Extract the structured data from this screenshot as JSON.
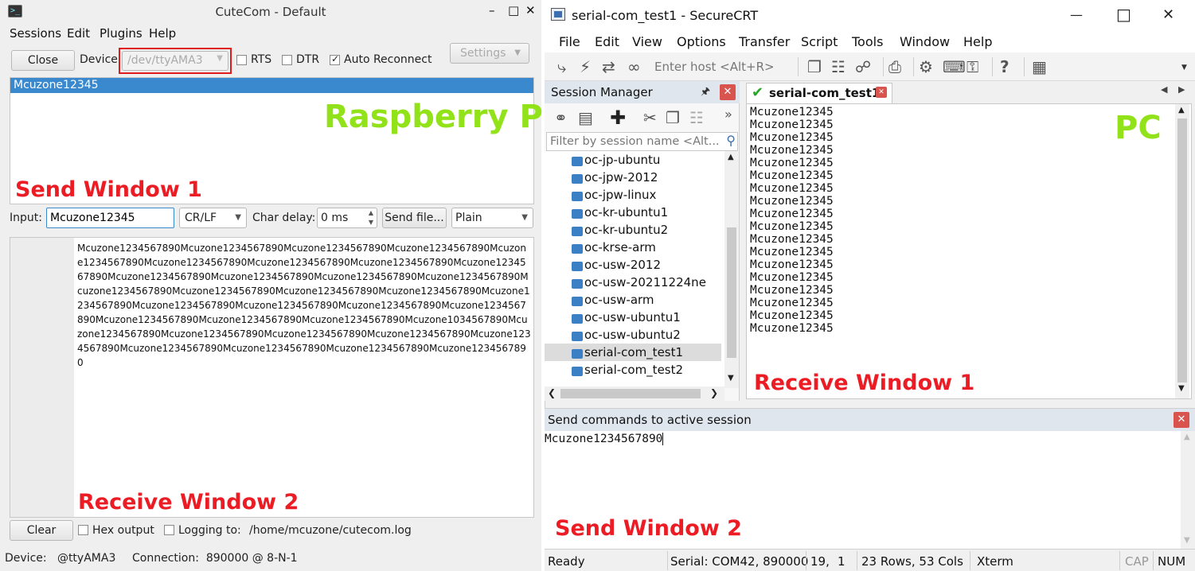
{
  "cutecom": {
    "window_title": "CuteCom - Default",
    "menu": [
      "Sessions",
      "Edit",
      "Plugins",
      "Help"
    ],
    "close_label": "Close",
    "device_label": "Device:",
    "device_value": "/dev/ttyAMA3",
    "rts_label": "RTS",
    "dtr_label": "DTR",
    "auto_reconnect_label": "Auto Reconnect",
    "auto_reconnect_checked": true,
    "settings_label": "Settings",
    "receive1_line": "Mcuzone12345",
    "overlay_raspberry": "Raspberry Pi",
    "overlay_send1": "Send Window 1",
    "input_label": "Input:",
    "input_value": "Mcuzone12345",
    "line_end": "CR/LF",
    "char_delay_label": "Char delay:",
    "char_delay_value": "0 ms",
    "send_file_label": "Send file...",
    "format_value": "Plain",
    "receive2_text": "Mcuzone1234567890Mcuzone1234567890Mcuzone1234567890Mcuzone1234567890Mcuzone1234567890Mcuzone1234567890Mcuzone1234567890Mcuzone1234567890Mcuzone1234567890Mcuzone1234567890Mcuzone1234567890Mcuzone1234567890Mcuzone1234567890Mcuzone1234567890Mcuzone1234567890Mcuzone1234567890Mcuzone1234567890Mcuzone1234567890Mcuzone1234567890Mcuzone1234567890Mcuzone1234567890Mcuzone1234567890Mcuzone1234567890Mcuzone1234567890Mcuzone1234567890Mcuzone1034567890Mcuzone1234567890Mcuzone1234567890Mcuzone1234567890Mcuzone1234567890Mcuzone1234567890Mcuzone1234567890Mcuzone1234567890Mcuzone1234567890Mcuzone1234567890",
    "overlay_receive2": "Receive Window 2",
    "clear_label": "Clear",
    "hex_output_label": "Hex output",
    "logging_label": "Logging to:",
    "logging_path": "/home/mcuzone/cutecom.log",
    "status_device": "Device:   @ttyAMA3",
    "status_connection": "Connection:  890000 @ 8-N-1"
  },
  "securecrt": {
    "window_title": "serial-com_test1 - SecureCRT",
    "menu": [
      "File",
      "Edit",
      "View",
      "Options",
      "Transfer",
      "Script",
      "Tools",
      "Window",
      "Help"
    ],
    "host_placeholder": "Enter host <Alt+R>",
    "session_manager_title": "Session Manager",
    "filter_placeholder": "Filter by session name <Alt...",
    "sessions": [
      "oc-jp-ubuntu",
      "oc-jpw-2012",
      "oc-jpw-linux",
      "oc-kr-ubuntu1",
      "oc-kr-ubuntu2",
      "oc-krse-arm",
      "oc-usw-2012",
      "oc-usw-20211224ne",
      "oc-usw-arm",
      "oc-usw-ubuntu1",
      "oc-usw-ubuntu2",
      "serial-com_test1",
      "serial-com_test2"
    ],
    "selected_session": "serial-com_test1",
    "tab_label": "serial-com_test1",
    "terminal_lines": [
      "Mcuzone12345",
      "Mcuzone12345",
      "Mcuzone12345",
      "Mcuzone12345",
      "Mcuzone12345",
      "Mcuzone12345",
      "Mcuzone12345",
      "Mcuzone12345",
      "Mcuzone12345",
      "Mcuzone12345",
      "Mcuzone12345",
      "Mcuzone12345",
      "Mcuzone12345",
      "Mcuzone12345",
      "Mcuzone12345",
      "Mcuzone12345",
      "Mcuzone12345",
      "Mcuzone12345"
    ],
    "overlay_pc": "PC",
    "overlay_receive1": "Receive Window 1",
    "send_commands_title": "Send commands to active session",
    "command_text": "Mcuzone1234567890",
    "overlay_send2": "Send Window 2",
    "status": {
      "ready": "Ready",
      "serial": "Serial: COM42, 890000",
      "row": "19,",
      "col": "1",
      "size": "23 Rows, 53 Cols",
      "term": "Xterm",
      "cap": "CAP",
      "num": "NUM"
    }
  },
  "colors": {
    "overlay_red": "#ec1c24",
    "overlay_green": "#92e21a",
    "selection_blue": "#3a89cf",
    "close_red": "#d9534f"
  }
}
